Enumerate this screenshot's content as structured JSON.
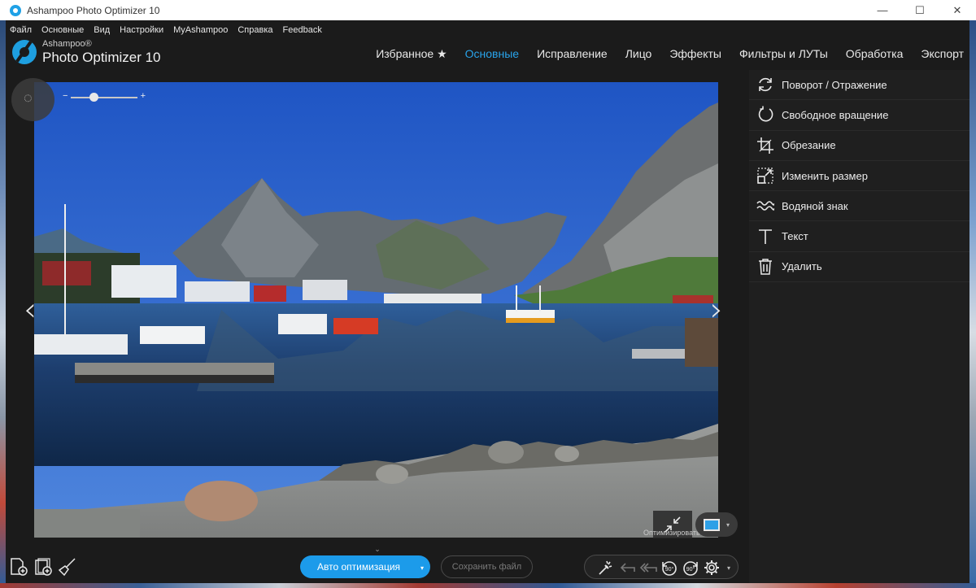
{
  "window": {
    "title": "Ashampoo Photo Optimizer 10",
    "controls": [
      "—",
      "☐",
      "✕"
    ]
  },
  "menu": [
    "Файл",
    "Основные",
    "Вид",
    "Настройки",
    "MyAshampoo",
    "Справка",
    "Feedback"
  ],
  "logo": {
    "brand": "Ashampoo®",
    "product": "Photo Optimizer 10"
  },
  "tabs": [
    {
      "label": "Избранное ★",
      "active": false
    },
    {
      "label": "Основные",
      "active": true
    },
    {
      "label": "Исправление",
      "active": false
    },
    {
      "label": "Лицо",
      "active": false
    },
    {
      "label": "Эффекты",
      "active": false
    },
    {
      "label": "Фильтры и ЛУТы",
      "active": false
    },
    {
      "label": "Обработка",
      "active": false
    },
    {
      "label": "Экспорт",
      "active": false
    }
  ],
  "zoom": {
    "minus": "−",
    "plus": "+",
    "level": 0.35
  },
  "viewer": {
    "prev_arrow": "‹",
    "next_arrow": "›",
    "compare_label": "Оптимизировать",
    "view_caret": "▾",
    "collapse": "⌄"
  },
  "tools": [
    {
      "label": "Поворот / Отражение",
      "icon": "rotate-flip-icon"
    },
    {
      "label": "Свободное вращение",
      "icon": "free-rotate-icon"
    },
    {
      "label": "Обрезание",
      "icon": "crop-icon"
    },
    {
      "label": "Изменить размер",
      "icon": "resize-icon"
    },
    {
      "label": "Водяной знак",
      "icon": "watermark-icon"
    },
    {
      "label": "Текст",
      "icon": "text-icon"
    },
    {
      "label": "Удалить",
      "icon": "delete-icon"
    }
  ],
  "bottom": {
    "auto_label": "Авто оптимизация",
    "auto_caret": "▾",
    "save_label": "Сохранить файл",
    "rotate_left_label": "90°",
    "rotate_right_label": "90°",
    "edit_caret": "▾"
  },
  "colors": {
    "accent": "#1c9bea",
    "active_tab": "#29a3ea",
    "background": "#1b1b1b",
    "panel": "#1f1f1f"
  }
}
